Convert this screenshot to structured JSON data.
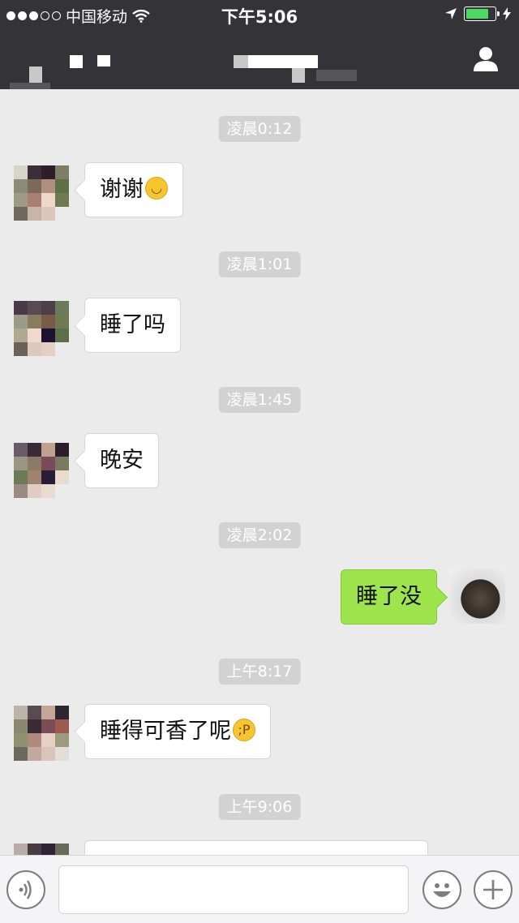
{
  "status_bar": {
    "carrier": "中国移动",
    "time": "下午5:06",
    "battery_color": "#4cd964"
  },
  "header": {
    "contact_icon": "person-icon"
  },
  "messages": [
    {
      "time": "凌晨0:12",
      "text": "谢谢",
      "emoji": "smile-emoji"
    },
    {
      "time": "凌晨1:01",
      "text": "睡了吗"
    },
    {
      "time": "凌晨1:45",
      "text": "晚安"
    },
    {
      "time": "凌晨2:02",
      "text": "睡了没"
    },
    {
      "time": "上午8:17",
      "text": "睡得可香了呢",
      "emoji": "wink-tongue-emoji"
    },
    {
      "time": "上午9:06"
    }
  ],
  "colors": {
    "header_bg": "#333338",
    "chat_bg": "#ebebeb",
    "sent_bubble": "#9ee54d"
  },
  "input_bar": {
    "voice_icon": "voice-icon",
    "emoji_icon": "emoji-icon",
    "add_icon": "plus-icon"
  }
}
